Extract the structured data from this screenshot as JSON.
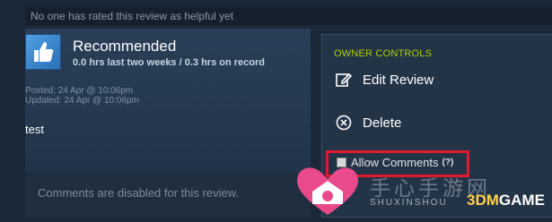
{
  "helpful": {
    "text": "No one has rated this review as helpful yet"
  },
  "review": {
    "verdict": "Recommended",
    "hours": "0.0 hrs last two weeks / 0.3 hrs on record",
    "posted": "Posted: 24 Apr @ 10:06pm",
    "updated": "Updated: 24 Apr @ 10:06pm",
    "body": "test",
    "comments_disabled": "Comments are disabled for this review."
  },
  "owner": {
    "heading": "OWNER CONTROLS",
    "edit_label": "Edit Review",
    "delete_label": "Delete",
    "allow_comments_label": "Allow Comments",
    "help_label": "(?)",
    "allow_comments_checked": false
  },
  "watermark": {
    "cn_text": "手心手游网",
    "sub_text": "SHUXINSHOU",
    "brand_prefix": "3DM",
    "brand_suffix": "GAME"
  },
  "colors": {
    "background": "#1b2838",
    "accent_green": "#acd000",
    "highlight_red": "#e0192f",
    "thumb_blue": "#4fa0e6"
  },
  "icons": [
    "thumbs-up-icon",
    "edit-icon",
    "delete-icon",
    "help-icon"
  ]
}
